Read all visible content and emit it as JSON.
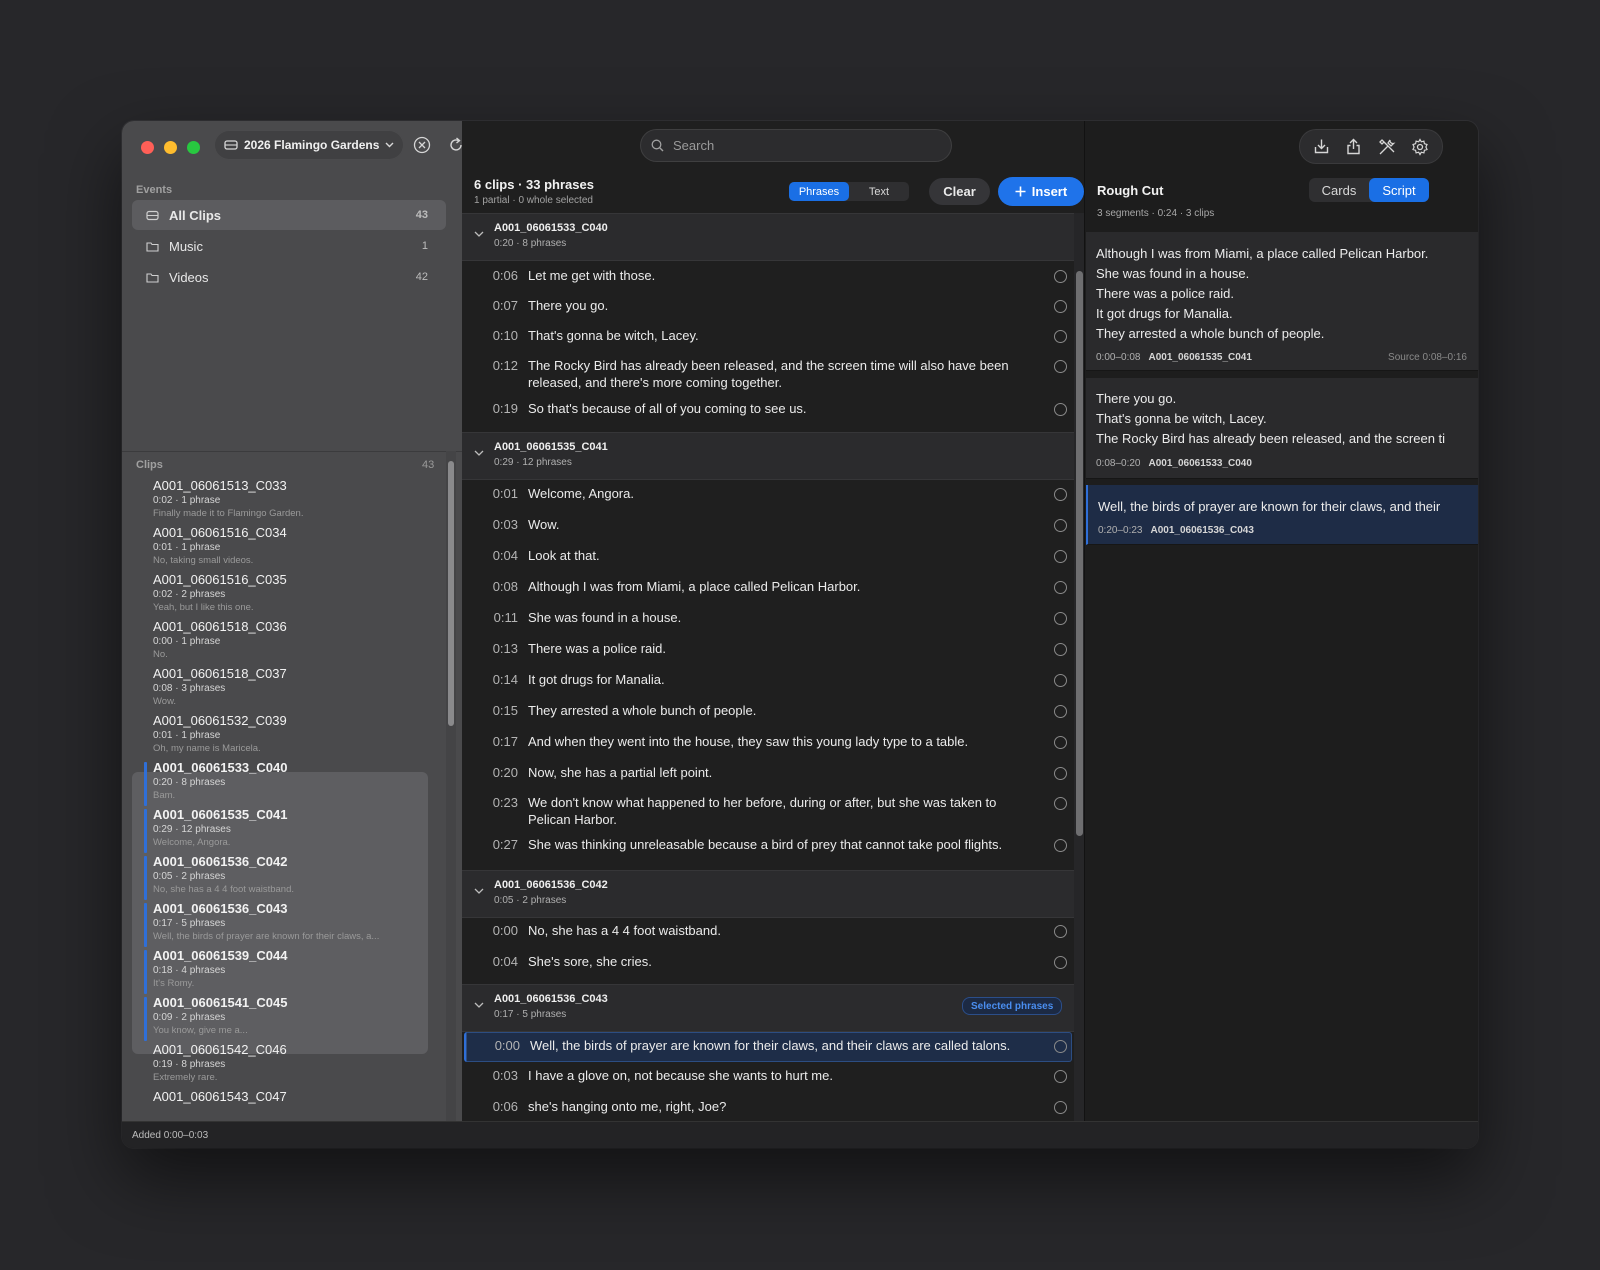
{
  "library": {
    "name": "2026 Flamingo Gardens"
  },
  "search": {
    "placeholder": "Search"
  },
  "events": {
    "label": "Events",
    "items": [
      {
        "label": "All Clips",
        "count": "43"
      },
      {
        "label": "Music",
        "count": "1"
      },
      {
        "label": "Videos",
        "count": "42"
      }
    ]
  },
  "clips": {
    "label": "Clips",
    "count": "43",
    "items": [
      {
        "name": "A001_06061513_C033",
        "meta": "0:02 · 1 phrase",
        "text": "Finally made it to Flamingo Garden."
      },
      {
        "name": "A001_06061516_C034",
        "meta": "0:01 · 1 phrase",
        "text": "No, taking small videos."
      },
      {
        "name": "A001_06061516_C035",
        "meta": "0:02 · 2 phrases",
        "text": "Yeah, but I like this one."
      },
      {
        "name": "A001_06061518_C036",
        "meta": "0:00 · 1 phrase",
        "text": "No."
      },
      {
        "name": "A001_06061518_C037",
        "meta": "0:08 · 3 phrases",
        "text": "Wow."
      },
      {
        "name": "A001_06061532_C039",
        "meta": "0:01 · 1 phrase",
        "text": "Oh, my name is Maricela."
      },
      {
        "name": "A001_06061533_C040",
        "meta": "0:20 · 8 phrases",
        "text": "Bam."
      },
      {
        "name": "A001_06061535_C041",
        "meta": "0:29 · 12 phrases",
        "text": "Welcome, Angora."
      },
      {
        "name": "A001_06061536_C042",
        "meta": "0:05 · 2 phrases",
        "text": "No, she has a 4 4 foot waistband."
      },
      {
        "name": "A001_06061536_C043",
        "meta": "0:17 · 5 phrases",
        "text": "Well, the birds of prayer are known for their claws, a..."
      },
      {
        "name": "A001_06061539_C044",
        "meta": "0:18 · 4 phrases",
        "text": "It's Romy."
      },
      {
        "name": "A001_06061541_C045",
        "meta": "0:09 · 2 phrases",
        "text": "You know, give me a..."
      },
      {
        "name": "A001_06061542_C046",
        "meta": "0:19 · 8 phrases",
        "text": "Extremely rare."
      },
      {
        "name": "A001_06061543_C047",
        "meta": "",
        "text": ""
      }
    ]
  },
  "middle": {
    "title": "6 clips · 33 phrases",
    "subtitle": "1 partial · 0 whole selected",
    "mode_phrases": "Phrases",
    "mode_text": "Text",
    "clear_label": "Clear",
    "insert_label": "Insert",
    "groups": [
      {
        "name": "A001_06061533_C040",
        "meta": "0:20 · 8 phrases",
        "badge": "",
        "phrases": [
          {
            "time": "0:06",
            "text": "Let me get with those."
          },
          {
            "time": "0:07",
            "text": "There you go."
          },
          {
            "time": "0:10",
            "text": "That's gonna be witch, Lacey."
          },
          {
            "time": "0:12",
            "text": "The Rocky Bird has already been released, and the screen time will also have been released, and there's more coming together."
          },
          {
            "time": "0:19",
            "text": "So that's because of all of you coming to see us."
          }
        ]
      },
      {
        "name": "A001_06061535_C041",
        "meta": "0:29 · 12 phrases",
        "badge": "",
        "phrases": [
          {
            "time": "0:01",
            "text": "Welcome, Angora."
          },
          {
            "time": "0:03",
            "text": "Wow."
          },
          {
            "time": "0:04",
            "text": "Look at that."
          },
          {
            "time": "0:08",
            "text": "Although I was from Miami, a place called Pelican Harbor."
          },
          {
            "time": "0:11",
            "text": "She was found in a house."
          },
          {
            "time": "0:13",
            "text": "There was a police raid."
          },
          {
            "time": "0:14",
            "text": "It got drugs for Manalia."
          },
          {
            "time": "0:15",
            "text": "They arrested a whole bunch of people."
          },
          {
            "time": "0:17",
            "text": "And when they went into the house, they saw this young lady type to a table."
          },
          {
            "time": "0:20",
            "text": "Now, she has a partial left point."
          },
          {
            "time": "0:23",
            "text": "We don't know what happened to her before, during or after, but she was taken to Pelican Harbor."
          },
          {
            "time": "0:27",
            "text": "She was thinking unreleasable because a bird of prey that cannot take pool flights."
          }
        ]
      },
      {
        "name": "A001_06061536_C042",
        "meta": "0:05 · 2 phrases",
        "badge": "",
        "phrases": [
          {
            "time": "0:00",
            "text": "No, she has a 4 4 foot waistband."
          },
          {
            "time": "0:04",
            "text": "She's sore, she cries."
          }
        ]
      },
      {
        "name": "A001_06061536_C043",
        "meta": "0:17 · 5 phrases",
        "badge": "Selected phrases",
        "phrases": [
          {
            "time": "0:00",
            "text": "Well, the birds of prayer are known for their claws, and their claws are called talons."
          },
          {
            "time": "0:03",
            "text": "I have a glove on, not because she wants to hurt me."
          },
          {
            "time": "0:06",
            "text": "she's hanging onto me, right, Joe?"
          }
        ]
      }
    ]
  },
  "rough_cut": {
    "title": "Rough Cut",
    "subtitle": "3 segments · 0:24 · 3 clips",
    "mode_cards": "Cards",
    "mode_script": "Script",
    "segments": [
      {
        "lines": [
          "Although I was from Miami, a place called Pelican Harbor.",
          "She was found in a house.",
          "There was a police raid.",
          "It got drugs for Manalia.",
          "They arrested a whole bunch of people."
        ],
        "range": "0:00–0:08",
        "clip": "A001_06061535_C041",
        "source": "Source 0:08–0:16"
      },
      {
        "lines": [
          "There you go.",
          "That's gonna be witch, Lacey.",
          "The Rocky Bird has already been released, and the screen ti"
        ],
        "range": "0:08–0:20",
        "clip": "A001_06061533_C040",
        "source": ""
      },
      {
        "lines": [
          "Well, the birds of prayer are known for their claws, and their"
        ],
        "range": "0:20–0:23",
        "clip": "A001_06061536_C043",
        "source": ""
      }
    ]
  },
  "status": {
    "text": "Added 0:00–0:03"
  },
  "colors": {
    "accent": "#1f73ea",
    "sidebar": "#4a4a4c",
    "content": "#1f1f1f"
  },
  "icons": [
    "library-icon",
    "chevron-down-icon",
    "close-circle-icon",
    "refresh-icon",
    "search-icon",
    "import-icon",
    "share-icon",
    "tools-icon",
    "gear-icon",
    "folder-icon",
    "plus-icon"
  ]
}
